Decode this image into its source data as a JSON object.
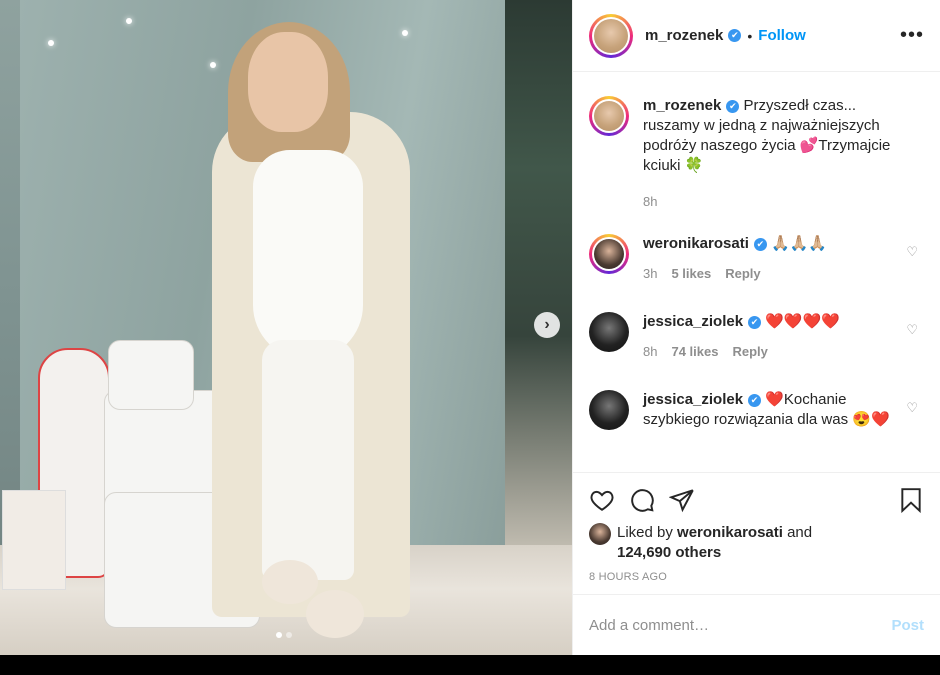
{
  "post": {
    "username": "m_rozenek",
    "follow_label": "Follow",
    "separator": "•",
    "more_label": "•••",
    "verified_mark": "✔",
    "image_slide_index": 1,
    "image_slide_count": 2,
    "next_icon": "chevron-right-icon"
  },
  "caption": {
    "username": "m_rozenek",
    "text": "Przyszedł czas... ruszamy w jedną z najważniejszych podróży naszego życia 💕Trzymajcie kciuki 🍀",
    "time": "8h"
  },
  "comments": [
    {
      "username": "weronikarosati",
      "text": "🙏🏼🙏🏼🙏🏼",
      "time": "3h",
      "likes": "5 likes",
      "reply": "Reply"
    },
    {
      "username": "jessica_ziolek",
      "text": "❤️❤️❤️❤️",
      "time": "8h",
      "likes": "74 likes",
      "reply": "Reply"
    },
    {
      "username": "jessica_ziolek",
      "text": "❤️Kochanie szybkiego rozwiązania dla was 😍❤️"
    }
  ],
  "likes": {
    "prefix": "Liked by",
    "user": "weronikarosati",
    "joiner": "and",
    "others": "124,690 others"
  },
  "timestamp": "8 HOURS AGO",
  "add_comment": {
    "placeholder": "Add a comment…",
    "post_label": "Post"
  },
  "colors": {
    "accent": "#0095f6",
    "verified": "#3897f0",
    "post_disabled": "#b2dffc",
    "muted": "#8e8e8e"
  },
  "icons": [
    "heart-icon",
    "comment-icon",
    "share-icon",
    "bookmark-icon",
    "small-heart-icon",
    "more-options-icon"
  ]
}
